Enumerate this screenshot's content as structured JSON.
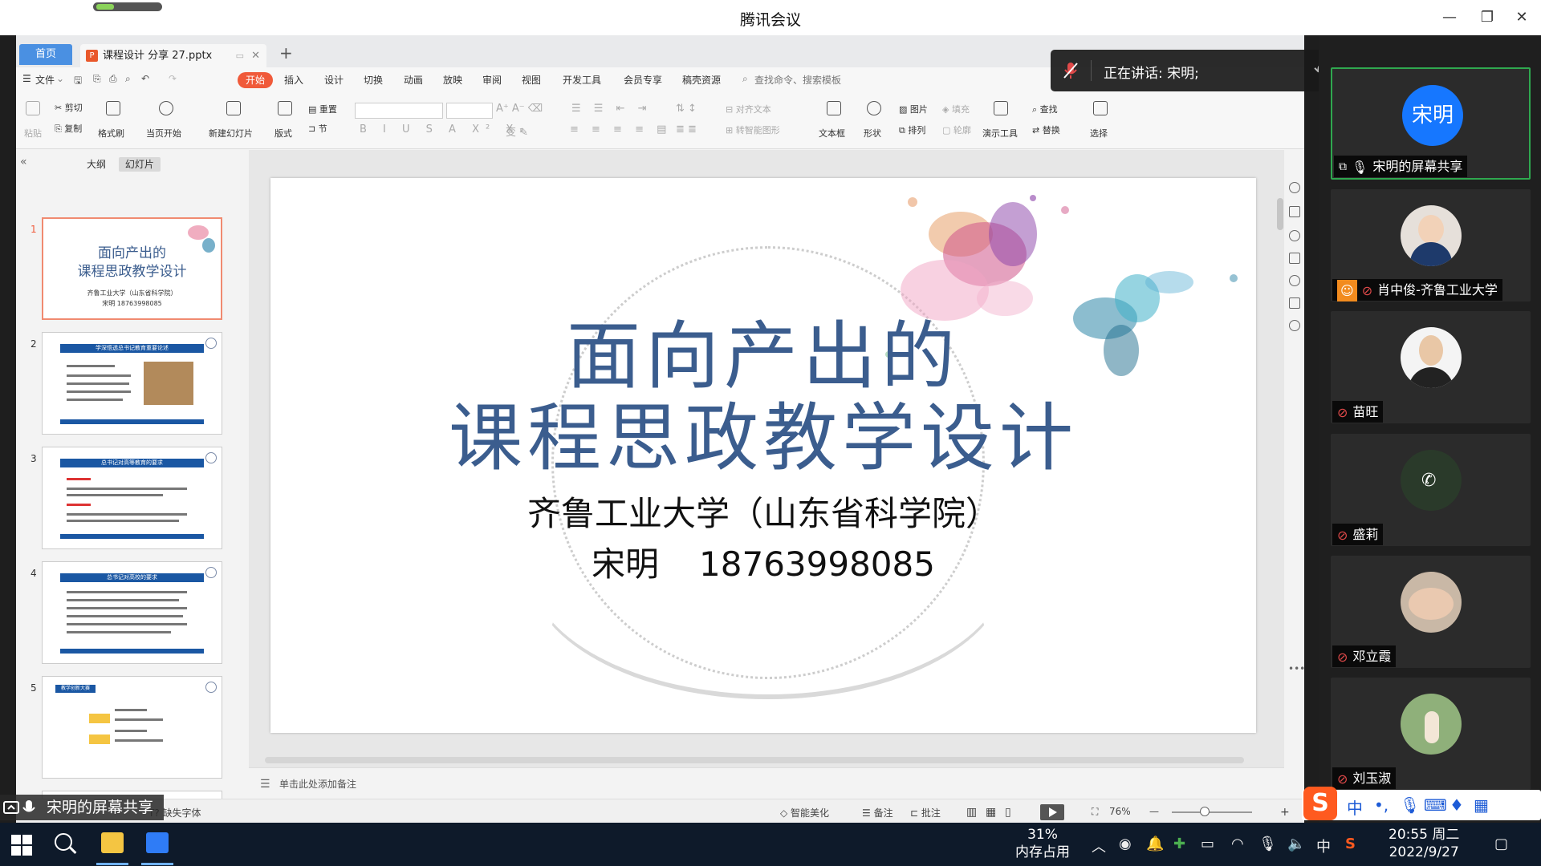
{
  "app": {
    "title": "腾讯会议"
  },
  "wps": {
    "tabs": {
      "home": "首页",
      "doc": "课程设计 分享 27.pptx"
    },
    "menu": [
      "文件",
      "开始",
      "插入",
      "设计",
      "切换",
      "动画",
      "放映",
      "审阅",
      "视图",
      "开发工具",
      "会员专享",
      "稿壳资源"
    ],
    "menu_search": "查找命令、搜索模板",
    "ribbon": {
      "paste": "粘贴",
      "cut": "剪切",
      "copy": "复制",
      "format_painter": "格式刷",
      "from_current": "当页开始",
      "new_slide": "新建幻灯片",
      "layout": "版式",
      "section": "节",
      "reset": "重置",
      "align_text": "对齐文本",
      "smartart": "转智能图形",
      "textbox": "文本框",
      "shape": "形状",
      "picture": "图片",
      "fill": "填充",
      "arrange": "排列",
      "outline": "轮廓",
      "presenter_tools": "演示工具",
      "find": "查找",
      "replace": "替换",
      "select": "选择"
    },
    "panel_tabs": {
      "outline": "大纲",
      "slides": "幻灯片"
    },
    "thumbs": [
      {
        "num": "1",
        "title1": "面向产出的",
        "title2": "课程思政教学设计",
        "sub1": "齐鲁工业大学（山东省科学院）",
        "sub2": "宋明  18763998085"
      },
      {
        "num": "2",
        "heading": "学深悟透总书记教育重要论述"
      },
      {
        "num": "3",
        "heading": "总书记对高等教育的要求"
      },
      {
        "num": "4",
        "heading": "总书记对高校的要求"
      },
      {
        "num": "5",
        "heading": "教学创新大赛"
      }
    ],
    "slide": {
      "title_line1": "面向产出的",
      "title_line2": "课程思政教学设计",
      "org": "齐鲁工业大学（山东省科学院）",
      "presenter": "宋明",
      "phone": "18763998085"
    },
    "notes_placeholder": "单击此处添加备注",
    "status": {
      "missing_font": "缺失字体",
      "smart_beautify": "智能美化",
      "notes": "备注",
      "comments": "批注",
      "zoom": "76%"
    }
  },
  "meeting": {
    "speaking": "正在讲话: 宋明;",
    "share_badge": "宋明的屏幕共享",
    "participants": [
      {
        "avatar_text": "宋明",
        "name": "宋明的屏幕共享",
        "active": true
      },
      {
        "avatar_text": "",
        "name": "肖中俊-齐鲁工业大学"
      },
      {
        "avatar_text": "",
        "name": "苗旺"
      },
      {
        "avatar_text": "",
        "name": "盛莉"
      },
      {
        "avatar_text": "",
        "name": "邓立霞"
      },
      {
        "avatar_text": "",
        "name": "刘玉淑"
      }
    ]
  },
  "taskbar": {
    "mem_pct": "31%",
    "mem_label": "内存占用",
    "ime": "中",
    "time": "20:55 周二",
    "date": "2022/9/27"
  },
  "colors": {
    "accent": "#f05a3a",
    "slide_title": "#3b5d8e",
    "active_border": "#2fa84f"
  }
}
